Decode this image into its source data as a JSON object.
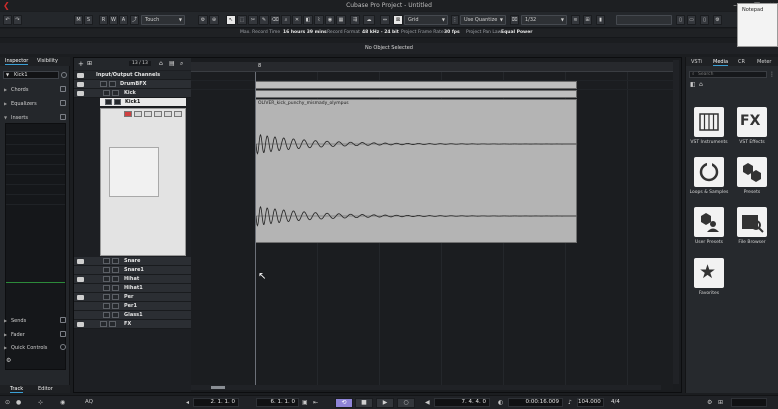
{
  "window": {
    "title": "Cubase Pro Project - Untitled"
  },
  "notepad": {
    "label": "Notepad"
  },
  "toolbar": {
    "buttons": [
      "M",
      "S",
      "R",
      "W",
      "A"
    ],
    "automation_mode": "Touch",
    "snap_type": "Grid",
    "quantize_mode": "Use Quantize",
    "quantize_value": "1/32"
  },
  "infoline": {
    "max_record_time_label": "Max. Record Time",
    "max_record_time": "16 hours 39 mins",
    "record_format_label": "Record Format",
    "record_format": "48 kHz - 24 bit",
    "frame_rate_label": "Project Frame Rate",
    "frame_rate": "30 fps",
    "pan_law_label": "Project Pan Law",
    "pan_law": "Equal Power"
  },
  "status": {
    "selection": "No Object Selected"
  },
  "inspector": {
    "tabs": [
      "Inspector",
      "Visibility"
    ],
    "track_name": "Kick1",
    "sections": [
      "Chords",
      "Equalizers",
      "Inserts"
    ],
    "bottom_sections": [
      "Sends",
      "Fader",
      "Quick Controls"
    ],
    "bottom_tabs": [
      "Track",
      "Editor"
    ]
  },
  "project": {
    "track_count": "13 / 13",
    "ruler_bar": "8",
    "tracks": [
      {
        "name": "Input/Output Channels"
      },
      {
        "name": "DrumBFX"
      },
      {
        "name": "Kick"
      },
      {
        "name": "Kick1"
      },
      {
        "name": "Snare"
      },
      {
        "name": "Snare1"
      },
      {
        "name": "Hihat"
      },
      {
        "name": "Hihat1"
      },
      {
        "name": "Per"
      },
      {
        "name": "Per1"
      },
      {
        "name": "Glass1"
      },
      {
        "name": "FX"
      }
    ],
    "audio_event": "OLIVER_kick_punchy_mismady_olympus"
  },
  "media": {
    "tabs": [
      "VSTi",
      "Media",
      "CR",
      "Meter"
    ],
    "search_placeholder": "Search",
    "tiles": [
      {
        "label": "VST Instruments",
        "icon": "piano-keys-icon"
      },
      {
        "label": "VST Effects",
        "icon": "fx-icon"
      },
      {
        "label": "Loops & Samples",
        "icon": "loop-icon"
      },
      {
        "label": "Presets",
        "icon": "hexagon-icon"
      },
      {
        "label": "User Presets",
        "icon": "user-preset-icon"
      },
      {
        "label": "File Browser",
        "icon": "file-browser-icon"
      },
      {
        "label": "Favorites",
        "icon": "star-icon"
      }
    ]
  },
  "transport": {
    "left_locator": "2. 1. 1.   0",
    "right_locator": "6. 1. 1.   0",
    "position_bars": "7. 4. 4.   0",
    "position_time": "0:00:16.009",
    "tempo": "104.000",
    "signature": "4/4",
    "aq": "AQ"
  }
}
